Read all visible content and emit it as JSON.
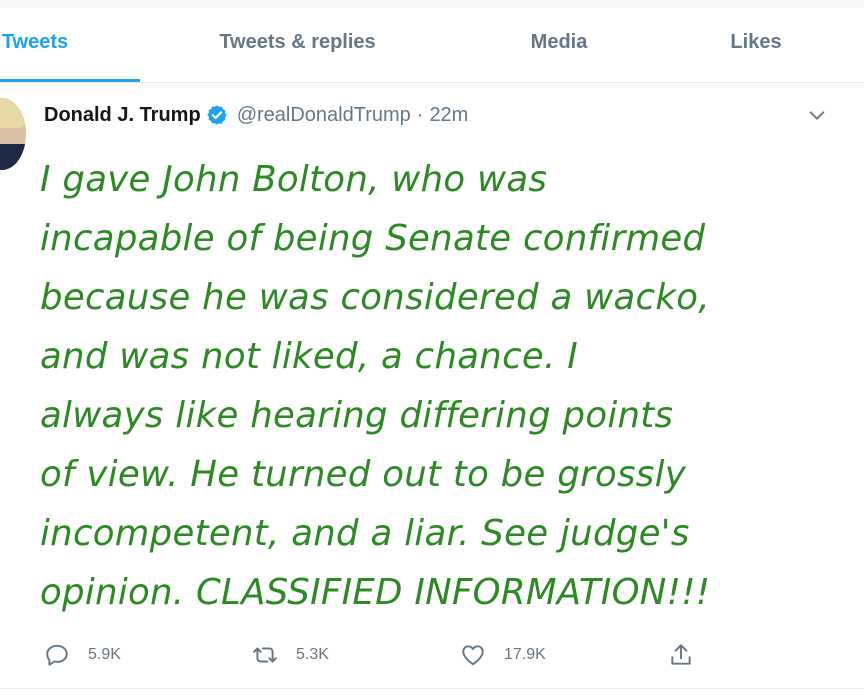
{
  "tabs": [
    {
      "label": "Tweets",
      "active": true
    },
    {
      "label": "Tweets & replies",
      "active": false
    },
    {
      "label": "Media",
      "active": false
    },
    {
      "label": "Likes",
      "active": false
    }
  ],
  "tweet": {
    "author_name": "Donald J. Trump",
    "handle": "@realDonaldTrump",
    "separator": "·",
    "time": "22m",
    "text_lines": [
      "I gave John Bolton, who was",
      "incapable of being Senate confirmed",
      "because he was considered a wacko,",
      "and was not liked, a chance. I",
      "always like hearing differing points",
      "of view. He turned out to be grossly",
      "incompetent, and a liar.   See judge's",
      "opinion. CLASSIFIED INFORMATION!!!"
    ],
    "text_color": "#2c8a22"
  },
  "actions": {
    "replies": "5.9K",
    "retweets": "5.3K",
    "likes": "17.9K"
  },
  "colors": {
    "accent": "#1da1f2",
    "muted": "#657786",
    "name": "#14171a"
  },
  "icons": [
    "verified-badge-icon",
    "chevron-down-icon",
    "reply-icon",
    "retweet-icon",
    "like-icon",
    "share-icon"
  ]
}
